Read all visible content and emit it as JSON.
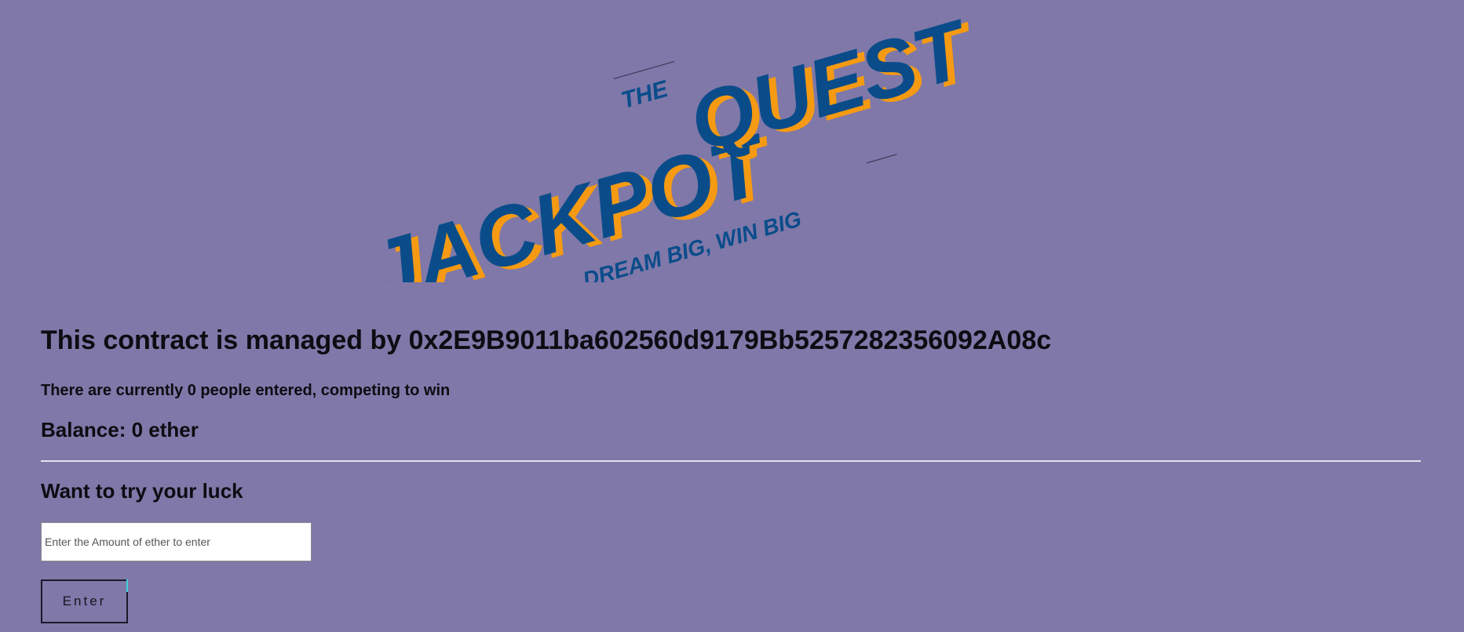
{
  "logo": {
    "the": "THE",
    "jackpot": "JACKPOT",
    "quest": "QUEST",
    "tagline": "DREAM BIG, WIN BIG"
  },
  "colors": {
    "background": "#7f78a8",
    "logo_blue": "#0a4c8a",
    "logo_orange": "#f59a12",
    "divider": "#e4e2ef"
  },
  "contract": {
    "manager_text": "This contract is managed by 0x2E9B9011ba602560d9179Bb5257282356092A08c",
    "players_text": "There are currently 0 people entered, competing to win",
    "balance_text": "Balance: 0 ether"
  },
  "entry_form": {
    "heading": "Want to try your luck",
    "amount_placeholder": "Enter the Amount of ether to enter",
    "amount_value": "",
    "submit_label": "Enter"
  }
}
